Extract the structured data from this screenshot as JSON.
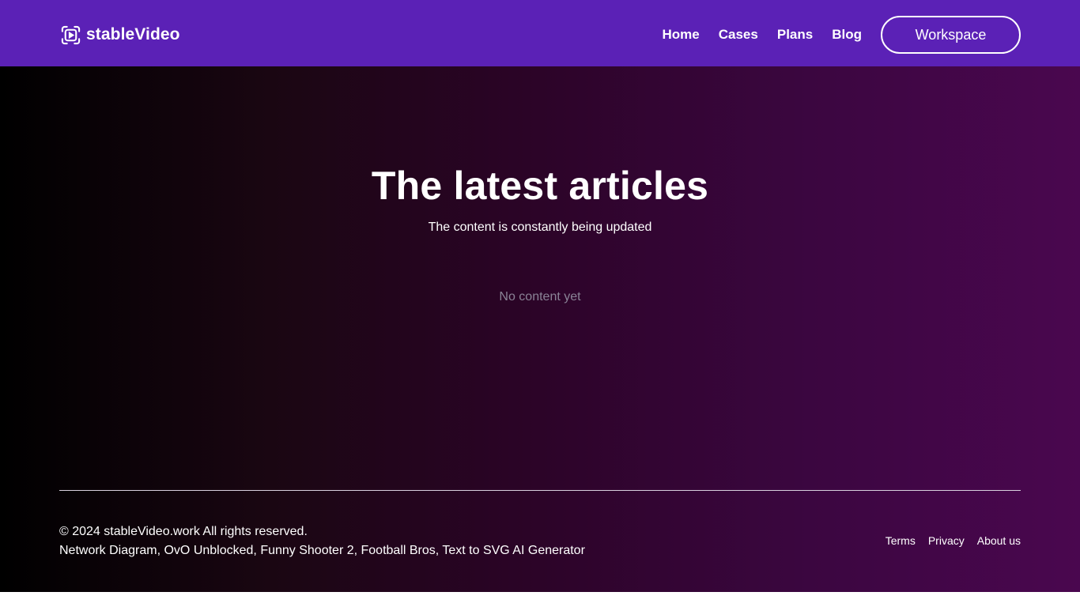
{
  "header": {
    "logo_icon": "play-in-frame-icon",
    "logo_text": "stableVideo",
    "nav": [
      {
        "label": "Home"
      },
      {
        "label": "Cases"
      },
      {
        "label": "Plans"
      },
      {
        "label": "Blog"
      }
    ],
    "workspace_label": "Workspace"
  },
  "main": {
    "title": "The latest articles",
    "subtitle": "The content is constantly being updated",
    "empty_text": "No content yet"
  },
  "footer": {
    "copyright": "© 2024 stableVideo.work All rights reserved.",
    "friend_links": [
      {
        "label": "Network Diagram"
      },
      {
        "label": "OvO Unblocked"
      },
      {
        "label": "Funny Shooter 2"
      },
      {
        "label": "Football Bros"
      },
      {
        "label": "Text to SVG AI Generator"
      }
    ],
    "links": [
      {
        "label": "Terms"
      },
      {
        "label": "Privacy"
      },
      {
        "label": "About us"
      }
    ]
  },
  "colors": {
    "header_bg": "#5b21b6",
    "text": "#ffffff",
    "muted": "#8a8396"
  }
}
